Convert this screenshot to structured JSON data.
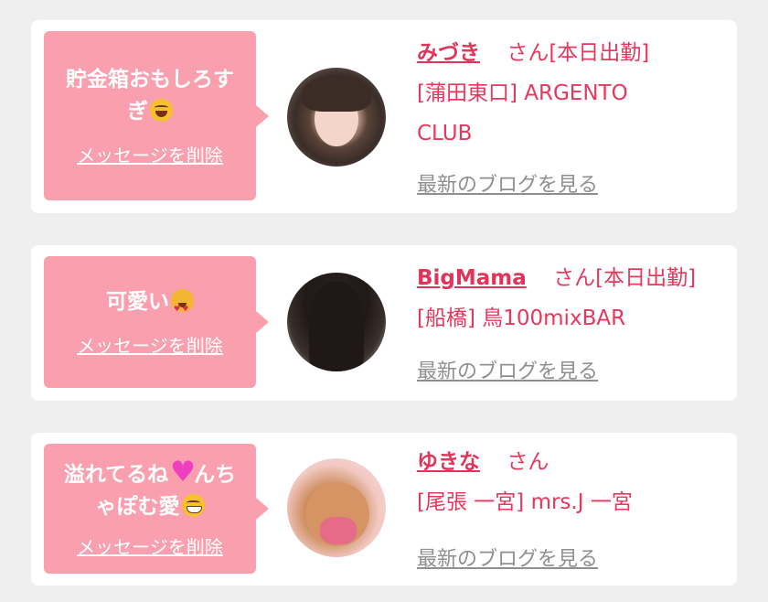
{
  "cards": [
    {
      "message_line1": "貯金箱おもしろす",
      "message_line2": "ぎ",
      "message_emoji": "tears-of-joy-emoji",
      "delete_label": "メッセージを削除",
      "name": "みづき",
      "honorific": "さん",
      "status": "[本日出勤]",
      "shop_line1": "[蒲田東口] ARGENTO",
      "shop_line2": "CLUB",
      "blog_label": "最新のブログを見る"
    },
    {
      "message_line1": "可愛い",
      "message_emoji": "heart-eyes-cat-emoji",
      "delete_label": "メッセージを削除",
      "name": "BigMama",
      "honorific": "さん",
      "status": "[本日出勤]",
      "shop_line1": "[船橋] 鳥100mixBAR",
      "blog_label": "最新のブログを見る"
    },
    {
      "message_line1a": "溢れてるね",
      "message_heart": "heart-emoji",
      "message_line1b": "んち",
      "message_line2": "ゃぽむ愛",
      "message_emoji": "grinning-face-emoji",
      "delete_label": "メッセージを削除",
      "name": "ゆきな",
      "honorific": "さん",
      "shop_line1": "[尾張 一宮] mrs.J 一宮",
      "blog_label": "最新のブログを見る"
    }
  ]
}
